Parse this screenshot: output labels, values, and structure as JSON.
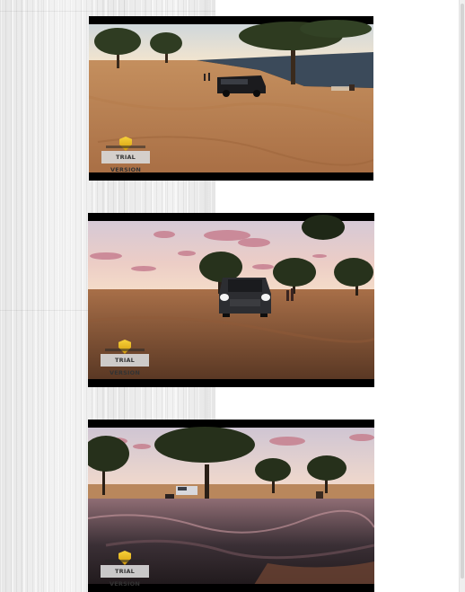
{
  "page": {
    "background": "#ffffff",
    "wood_panel": "#ececec"
  },
  "gallery": {
    "screenshots": [
      {
        "scene": "van-by-lake-daylight",
        "watermark_label": "TRIAL VERSION"
      },
      {
        "scene": "van-headlights-sunset-field",
        "watermark_label": "TRIAL VERSION"
      },
      {
        "scene": "lake-reflection-dusk",
        "watermark_label": "TRIAL VERSION"
      }
    ]
  },
  "colors": {
    "ground": "#b87a48",
    "sky_sunset": "#e9c6c0",
    "cloud": "#c9808f",
    "tree": "#2e3b20",
    "watermark_shield": "#f2c21c"
  }
}
